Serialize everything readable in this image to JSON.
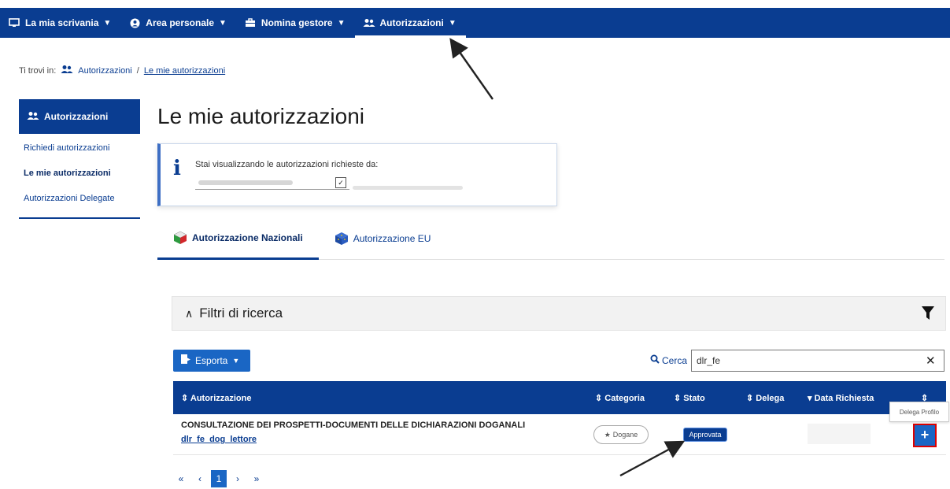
{
  "topnav": {
    "items": [
      {
        "label": "La mia scrivania",
        "icon": "monitor-icon"
      },
      {
        "label": "Area personale",
        "icon": "user-circle-icon"
      },
      {
        "label": "Nomina gestore",
        "icon": "briefcase-icon"
      },
      {
        "label": "Autorizzazioni",
        "icon": "users-icon",
        "active": true
      }
    ]
  },
  "breadcrumb": {
    "prefix": "Ti trovi in:",
    "parent": "Autorizzazioni",
    "separator": "/",
    "current": "Le mie autorizzazioni"
  },
  "sidebar": {
    "header": "Autorizzazioni",
    "items": [
      {
        "label": "Richiedi autorizzazioni"
      },
      {
        "label": "Le mie autorizzazioni",
        "current": true
      },
      {
        "label": "Autorizzazioni Delegate"
      }
    ]
  },
  "page": {
    "title": "Le mie autorizzazioni"
  },
  "info": {
    "text": "Stai visualizzando le autorizzazioni richieste da:"
  },
  "tabs": [
    {
      "label": "Autorizzazione Nazionali",
      "active": true
    },
    {
      "label": "Autorizzazione EU"
    }
  ],
  "filters": {
    "title": "Filtri di ricerca"
  },
  "toolbar": {
    "export_label": "Esporta",
    "search_label": "Cerca",
    "search_value": "dlr_fe"
  },
  "table": {
    "headers": [
      "Autorizzazione",
      "Categoria",
      "Stato",
      "Delega",
      "Data Richiesta"
    ],
    "rows": [
      {
        "title": "CONSULTAZIONE DEI PROSPETTI-DOCUMENTI DELLE DICHIARAZIONI DOGANALI",
        "code": "dlr_fe_dog_lettore",
        "categoria": "Dogane",
        "stato": "Approvata"
      }
    ],
    "action_tooltip": "Delega Profilo"
  },
  "pagination": {
    "first": "«",
    "prev": "‹",
    "current": "1",
    "next": "›",
    "last": "»"
  },
  "colors": {
    "brand": "#0a3d91",
    "accent": "#1a66c4",
    "highlight": "#dd0000"
  }
}
